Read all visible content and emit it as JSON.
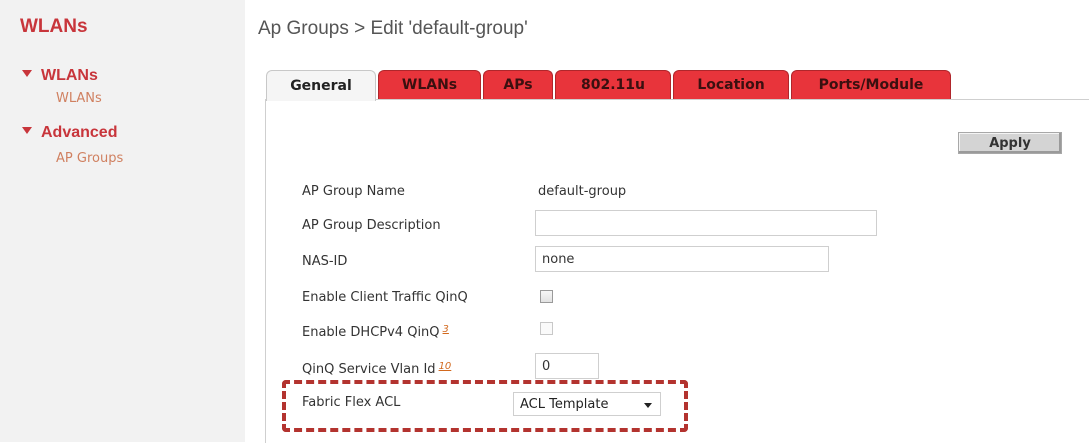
{
  "sidebar": {
    "title": "WLANs",
    "groups": [
      {
        "label": "WLANs",
        "items": [
          "WLANs"
        ]
      },
      {
        "label": "Advanced",
        "items": [
          "AP Groups"
        ]
      }
    ]
  },
  "page_title": "Ap Groups > Edit  'default-group'",
  "tabs": [
    "General",
    "WLANs",
    "APs",
    "802.11u",
    "Location",
    "Ports/Module"
  ],
  "active_tab": "General",
  "apply_label": "Apply",
  "form": {
    "ap_group_name_label": "AP Group Name",
    "ap_group_name_value": "default-group",
    "ap_group_desc_label": "AP Group Description",
    "ap_group_desc_value": "",
    "nas_id_label": "NAS-ID",
    "nas_id_value": "none",
    "client_qinq_label": "Enable Client Traffic QinQ",
    "client_qinq_checked": false,
    "dhcp_qinq_label": "Enable DHCPv4 QinQ",
    "dhcp_qinq_note": "3",
    "dhcp_qinq_checked": false,
    "qinq_vlan_label": "QinQ Service Vlan Id",
    "qinq_vlan_note": "10",
    "qinq_vlan_value": "0",
    "fabric_acl_label": "Fabric Flex ACL",
    "fabric_acl_value": "ACL Template"
  },
  "colors": {
    "accent": "#c8353b",
    "tab_red": "#e8343b",
    "highlight_dashed": "#b3332f"
  }
}
